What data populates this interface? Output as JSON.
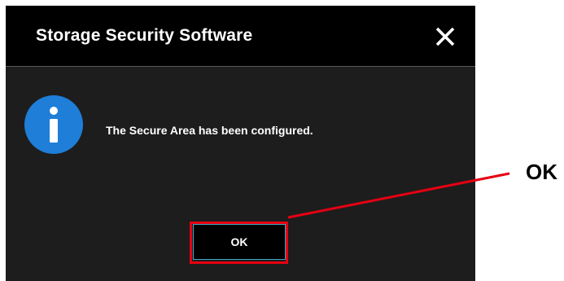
{
  "dialog": {
    "title": "Storage Security Software",
    "message": "The Secure Area has been configured.",
    "ok_label": "OK",
    "close_icon": "close-icon",
    "info_icon": "info-icon"
  },
  "annotation": {
    "label": "OK",
    "color": "#e60012"
  },
  "colors": {
    "titlebar": "#000000",
    "body": "#1d1d1d",
    "info_icon": "#1e7ed8"
  }
}
